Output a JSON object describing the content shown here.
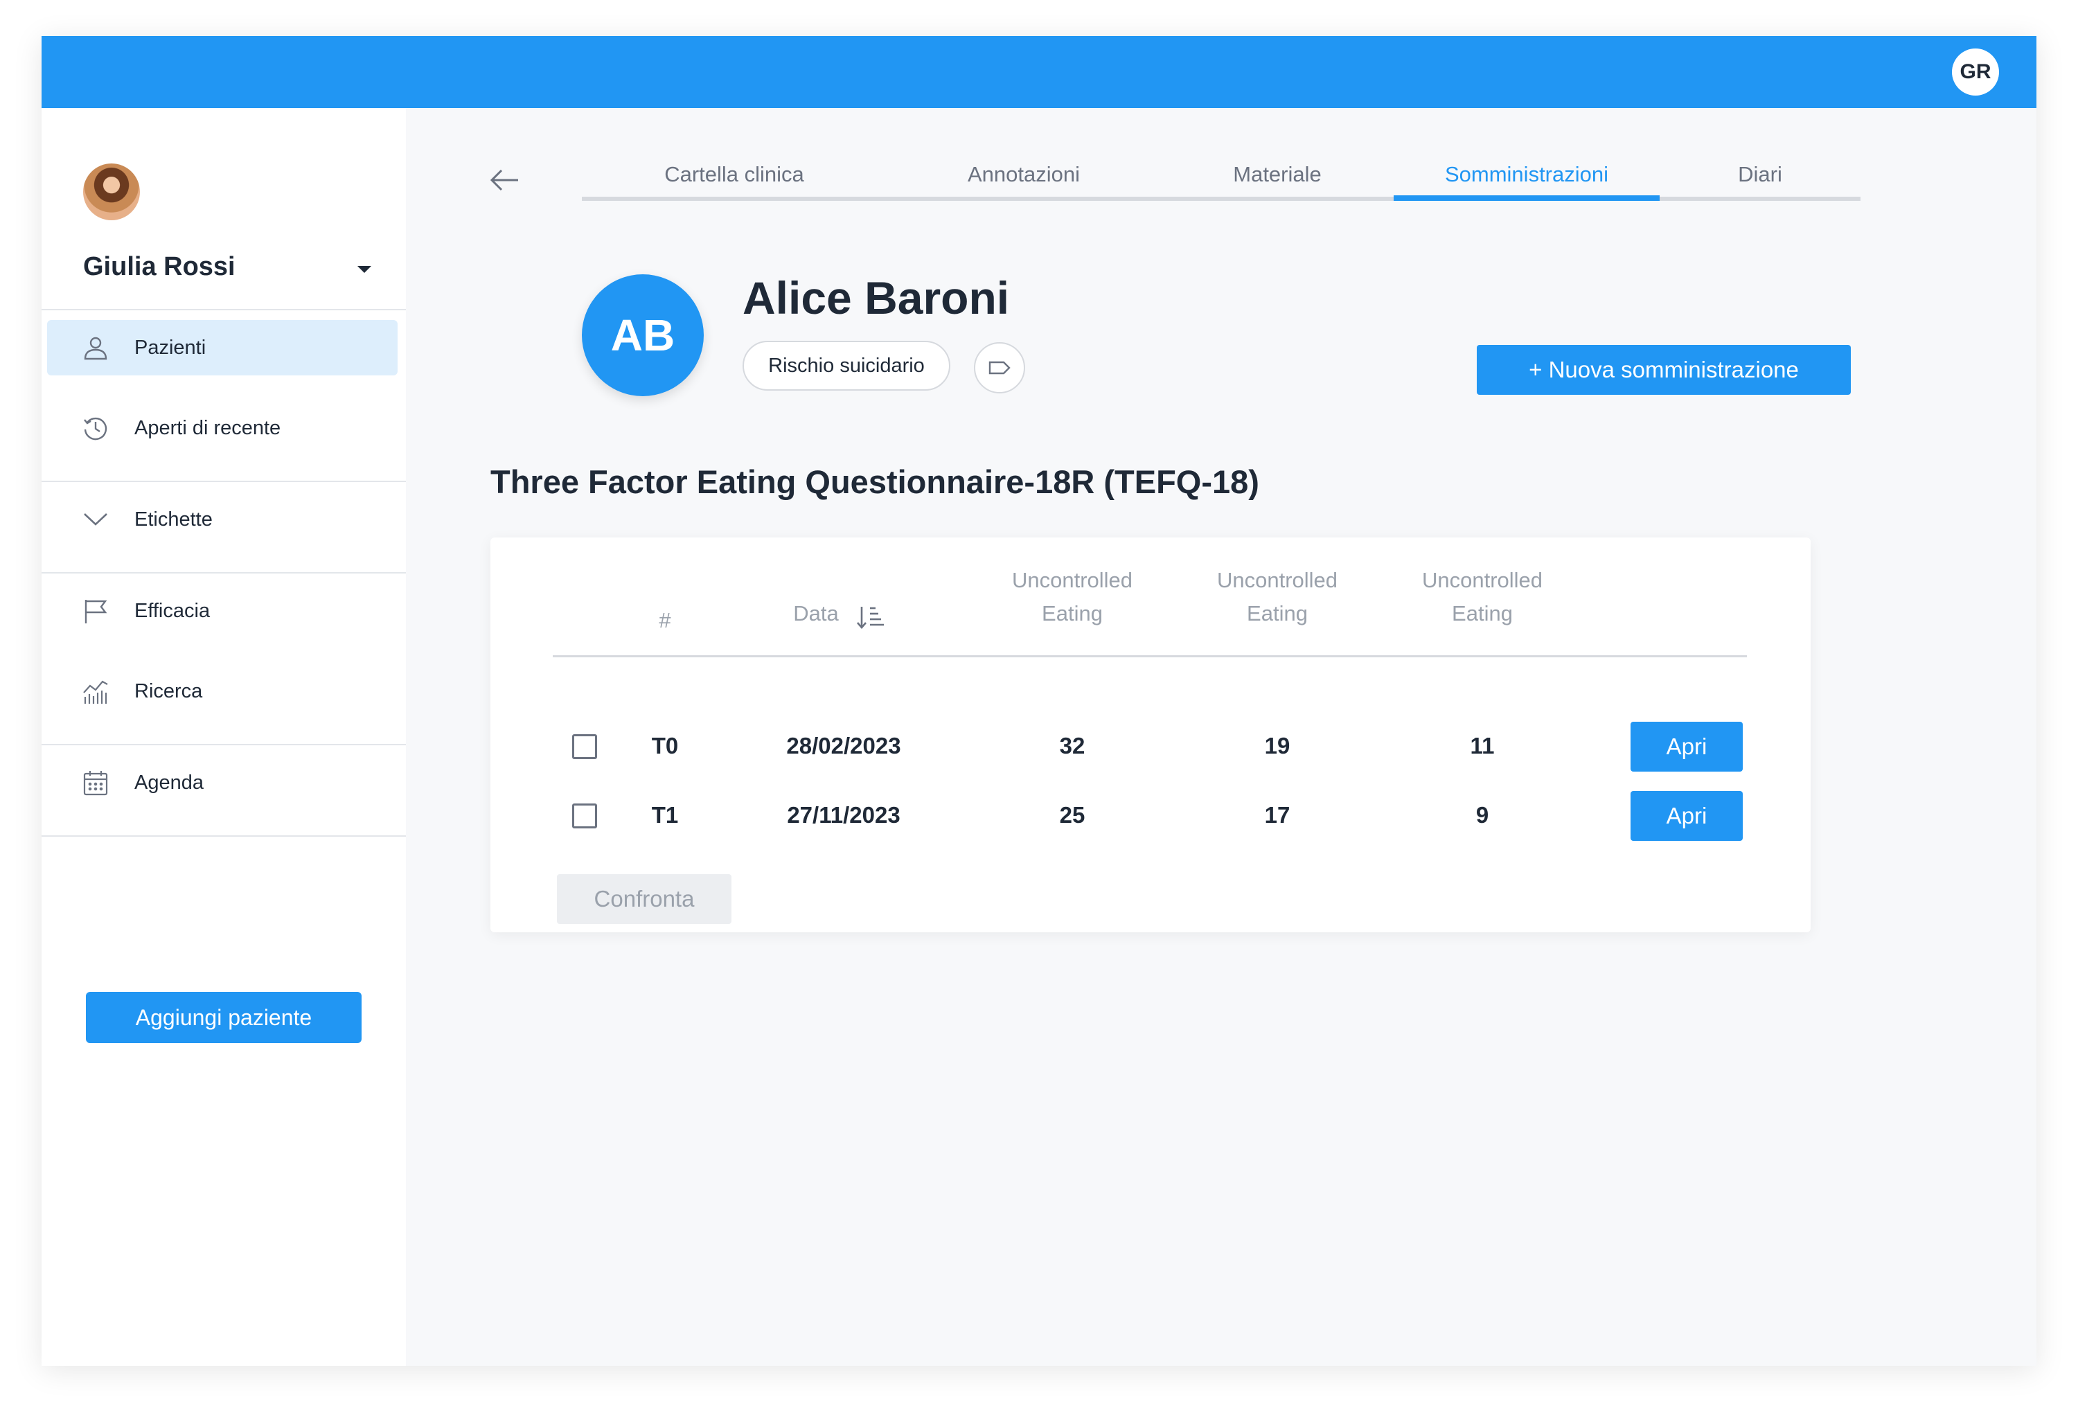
{
  "topbar": {
    "user_initials": "GR"
  },
  "sidebar": {
    "user_name": "Giulia Rossi",
    "items": [
      {
        "label": "Pazienti",
        "icon": "user-icon",
        "active": true
      },
      {
        "label": "Aperti di recente",
        "icon": "history-icon",
        "active": false
      },
      {
        "label": "Etichette",
        "icon": "chevron-down-icon",
        "active": false
      },
      {
        "label": "Efficacia",
        "icon": "flag-icon",
        "active": false
      },
      {
        "label": "Ricerca",
        "icon": "chart-icon",
        "active": false
      },
      {
        "label": "Agenda",
        "icon": "calendar-icon",
        "active": false
      }
    ],
    "add_patient_label": "Aggiungi paziente"
  },
  "tabs": [
    {
      "label": "Cartella clinica",
      "active": false
    },
    {
      "label": "Annotazioni",
      "active": false
    },
    {
      "label": "Materiale",
      "active": false
    },
    {
      "label": "Somministrazioni",
      "active": true
    },
    {
      "label": "Diari",
      "active": false
    }
  ],
  "patient": {
    "initials": "AB",
    "name": "Alice Baroni",
    "tag": "Rischio suicidario"
  },
  "new_admin_label": "+  Nuova somministrazione",
  "questionnaire": {
    "title": "Three Factor Eating Questionnaire-18R (TEFQ-18)",
    "columns": {
      "number": "#",
      "date": "Data",
      "score1_line1": "Uncontrolled",
      "score1_line2": "Eating",
      "score2_line1": "Uncontrolled",
      "score2_line2": "Eating",
      "score3_line1": "Uncontrolled",
      "score3_line2": "Eating"
    },
    "rows": [
      {
        "id": "T0",
        "date": "28/02/2023",
        "s1": "32",
        "s2": "19",
        "s3": "11",
        "action": "Apri"
      },
      {
        "id": "T1",
        "date": "27/11/2023",
        "s1": "25",
        "s2": "17",
        "s3": "9",
        "action": "Apri"
      }
    ],
    "compare_label": "Confronta"
  },
  "colors": {
    "accent": "#2196f3",
    "active_nav_bg": "#ddeefc"
  }
}
